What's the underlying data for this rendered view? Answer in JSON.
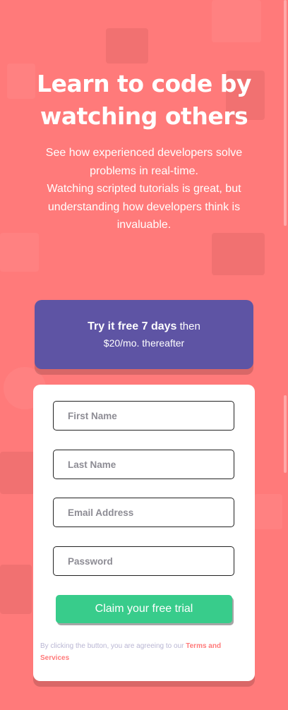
{
  "hero": {
    "title": "Learn to code by watching others",
    "description_line1": "See how experienced developers solve problems in real-time.",
    "description_line2": "Watching scripted tutorials is great, but understanding how developers think is invaluable."
  },
  "trial_banner": {
    "bold_text": "Try it free 7 days",
    "rest_text": " then",
    "line2": "$20/mo. thereafter"
  },
  "form": {
    "first_name": {
      "placeholder": "First Name",
      "value": ""
    },
    "last_name": {
      "placeholder": "Last Name",
      "value": ""
    },
    "email": {
      "placeholder": "Email Address",
      "value": ""
    },
    "password": {
      "placeholder": "Password",
      "value": ""
    },
    "submit_label": "Claim your free trial",
    "terms_prefix": "By clicking the button, you are agreeing to our ",
    "terms_link": "Terms and Services"
  },
  "colors": {
    "background": "#ff7a7a",
    "banner": "#5e54a4",
    "button": "#38cc8b",
    "link": "#ff7a7a"
  }
}
